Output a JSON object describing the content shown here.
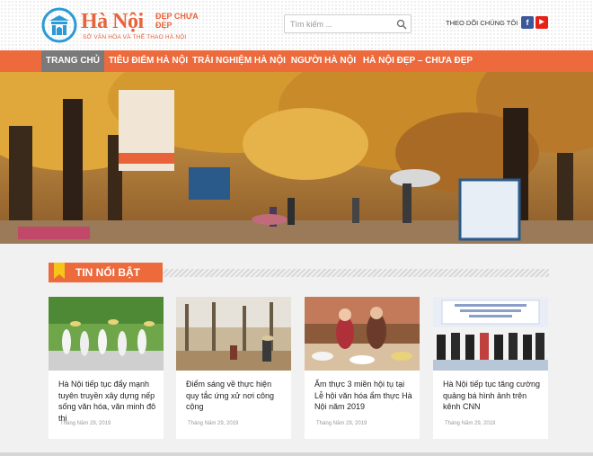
{
  "brand": {
    "name": "Hà Nội",
    "tagline": "ĐẸP CHƯA ĐẸP",
    "subtitle": "SỞ VĂN HÓA VÀ THỂ THAO HÀ NỘI",
    "color": "#e8633a"
  },
  "search": {
    "placeholder": "Tìm kiếm ...",
    "value": ""
  },
  "social": {
    "follow_label": "THEO DÕI CHÚNG TÔI",
    "facebook": "f",
    "youtube": "▶"
  },
  "nav": {
    "accent": "#ec6a3c",
    "items": [
      {
        "label": "TRANG CHỦ",
        "active": true
      },
      {
        "label": "TIÊU ĐIỂM HÀ NỘI"
      },
      {
        "label": "TRẢI NGHIỆM HÀ NỘI"
      },
      {
        "label": "NGƯỜI HÀ NỘI"
      },
      {
        "label": "HÀ NỘI ĐẸP – CHƯA ĐẸP"
      }
    ]
  },
  "section": {
    "title": "TIN NỔI BẬT"
  },
  "cards": [
    {
      "title": "Hà Nội tiếp tục đẩy mạnh tuyên truyền xây dựng nếp sống văn hóa, văn minh đô thị",
      "date": "Tháng Năm 29, 2019"
    },
    {
      "title": "Điểm sáng về thực hiện quy tắc ứng xử nơi công cộng",
      "date": "Tháng Năm 29, 2019"
    },
    {
      "title": "Ẩm thực 3 miền hội tụ tại Lễ hội văn hóa ẩm thực Hà Nội năm 2019",
      "date": "Tháng Năm 29, 2019"
    },
    {
      "title": "Hà Nội tiếp tục tăng cường quảng bá hình ảnh trên kênh CNN",
      "date": "Tháng Năm 29, 2019"
    }
  ]
}
